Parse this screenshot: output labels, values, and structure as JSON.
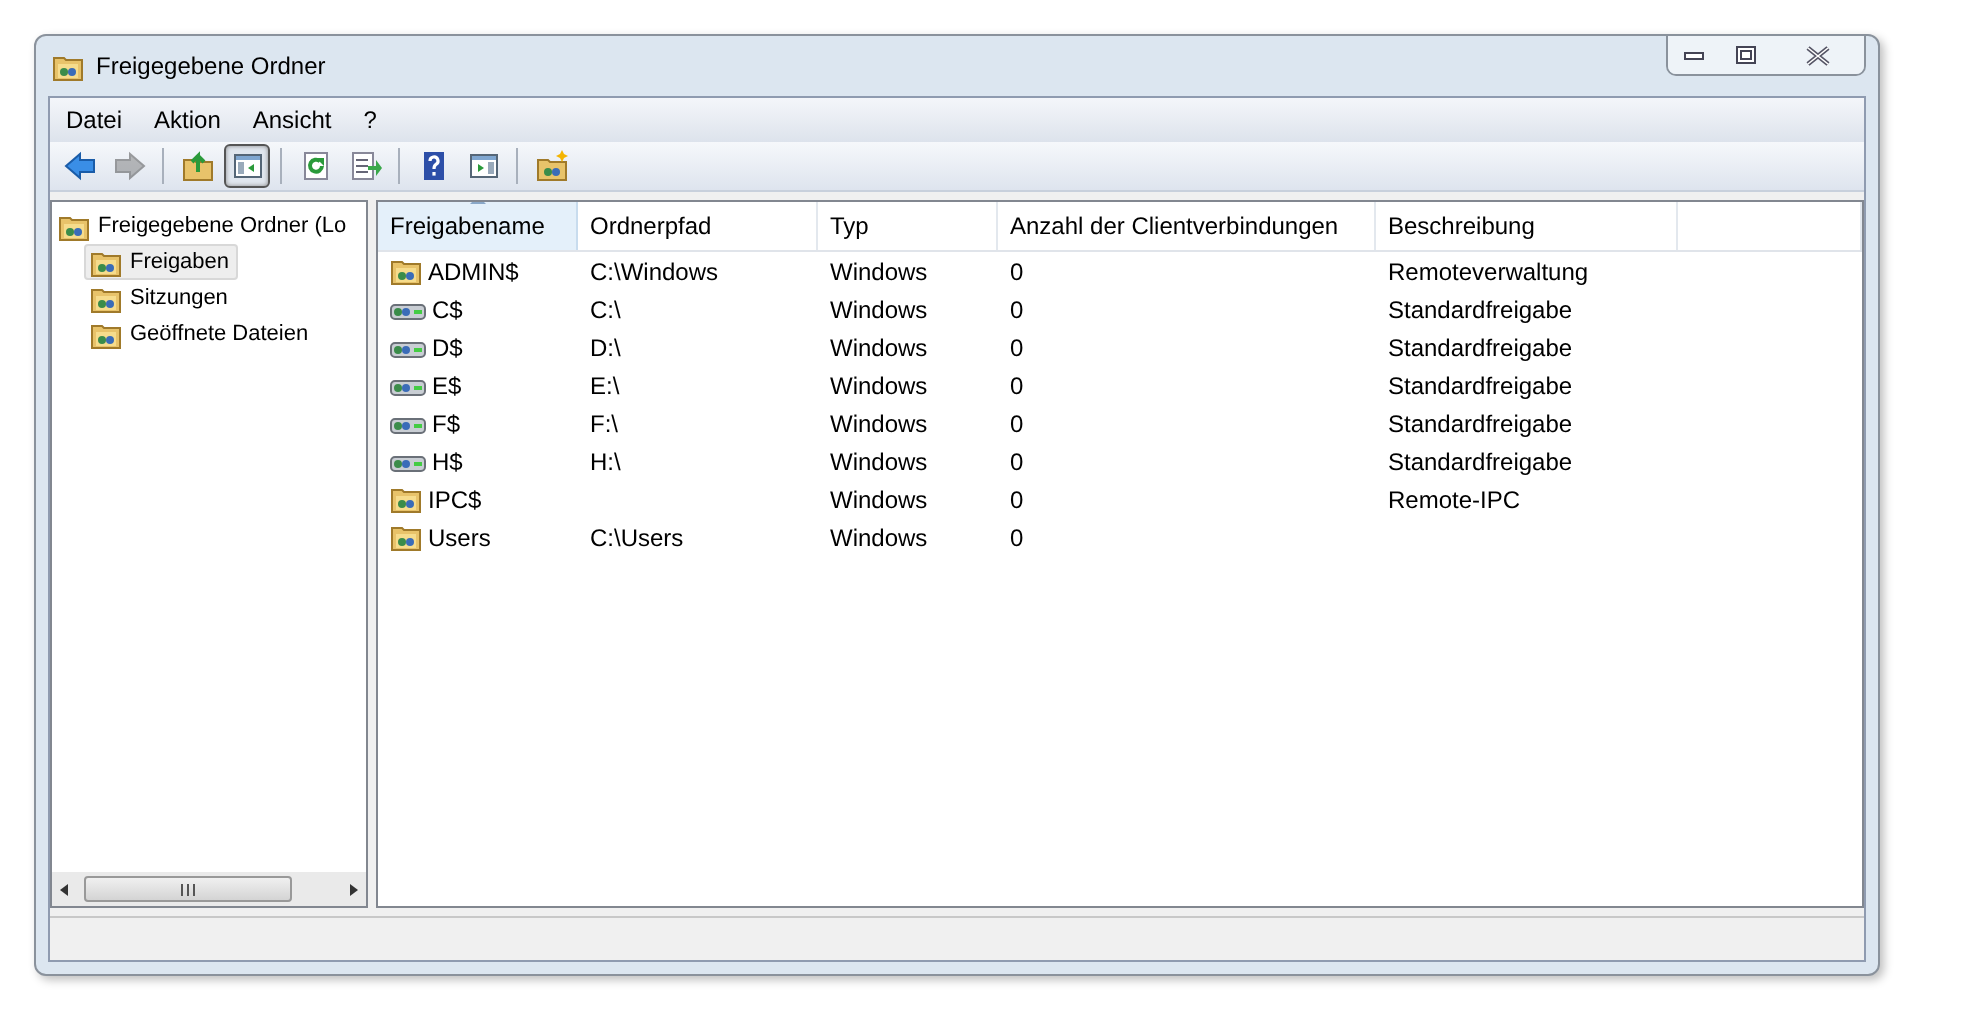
{
  "window": {
    "title": "Freigegebene Ordner"
  },
  "menu": [
    "Datei",
    "Aktion",
    "Ansicht",
    "?"
  ],
  "toolbar": [
    {
      "kind": "back",
      "disabled": false,
      "pressed": false
    },
    {
      "kind": "forward",
      "disabled": true,
      "pressed": false
    },
    {
      "kind": "separator"
    },
    {
      "kind": "up",
      "disabled": false,
      "pressed": false
    },
    {
      "kind": "tree",
      "disabled": false,
      "pressed": true
    },
    {
      "kind": "separator"
    },
    {
      "kind": "refresh",
      "disabled": false,
      "pressed": false
    },
    {
      "kind": "export",
      "disabled": false,
      "pressed": false
    },
    {
      "kind": "separator"
    },
    {
      "kind": "help",
      "disabled": false,
      "pressed": false
    },
    {
      "kind": "panel",
      "disabled": false,
      "pressed": false
    },
    {
      "kind": "separator"
    },
    {
      "kind": "newshare",
      "disabled": false,
      "pressed": false
    }
  ],
  "tree": [
    {
      "label": "Freigegebene Ordner (Lo",
      "selected": false,
      "children": [
        {
          "label": "Freigaben",
          "selected": true
        },
        {
          "label": "Sitzungen",
          "selected": false
        },
        {
          "label": "Geöffnete Dateien",
          "selected": false
        }
      ]
    }
  ],
  "table": {
    "columns": [
      {
        "label": "Freigabename",
        "sorted": true
      },
      {
        "label": "Ordnerpfad",
        "sorted": false
      },
      {
        "label": "Typ",
        "sorted": false
      },
      {
        "label": "Anzahl der Clientverbindungen",
        "sorted": false
      },
      {
        "label": "Beschreibung",
        "sorted": false
      }
    ],
    "rows": [
      {
        "kind": "folder",
        "cells": [
          "ADMIN$",
          "C:\\Windows",
          "Windows",
          "0",
          "Remoteverwaltung"
        ]
      },
      {
        "kind": "drive",
        "cells": [
          "C$",
          "C:\\",
          "Windows",
          "0",
          "Standardfreigabe"
        ]
      },
      {
        "kind": "drive",
        "cells": [
          "D$",
          "D:\\",
          "Windows",
          "0",
          "Standardfreigabe"
        ]
      },
      {
        "kind": "drive",
        "cells": [
          "E$",
          "E:\\",
          "Windows",
          "0",
          "Standardfreigabe"
        ]
      },
      {
        "kind": "drive",
        "cells": [
          "F$",
          "F:\\",
          "Windows",
          "0",
          "Standardfreigabe"
        ]
      },
      {
        "kind": "drive",
        "cells": [
          "H$",
          "H:\\",
          "Windows",
          "0",
          "Standardfreigabe"
        ]
      },
      {
        "kind": "folder",
        "cells": [
          "IPC$",
          "",
          "Windows",
          "0",
          "Remote-IPC"
        ]
      },
      {
        "kind": "folder",
        "cells": [
          "Users",
          "C:\\Users",
          "Windows",
          "0",
          ""
        ]
      }
    ]
  }
}
